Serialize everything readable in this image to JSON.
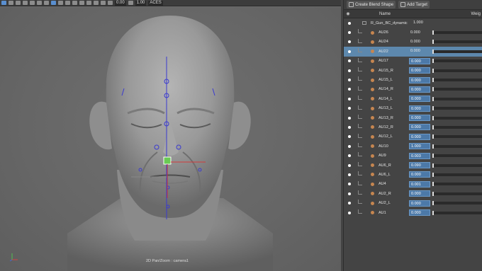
{
  "toolbar": {
    "field1": "0.00",
    "field2": "1.00",
    "color_space": "ACES"
  },
  "viewport": {
    "camera_label": "2D Pan/Zoom : camera1"
  },
  "panel": {
    "create_blend_shape": "Create Blend Shape",
    "add_target": "Add Target",
    "col_name": "Name",
    "col_weight": "Weig"
  },
  "blendshape": {
    "name": "R_Gun_BC_dynamic",
    "value": "1.000"
  },
  "targets": [
    {
      "name": "AU26",
      "value": "0.000",
      "boxed": false,
      "selected": false
    },
    {
      "name": "AU24",
      "value": "0.000",
      "boxed": false,
      "selected": false
    },
    {
      "name": "AU22",
      "value": "0.000",
      "boxed": false,
      "selected": true
    },
    {
      "name": "AU17",
      "value": "0.000",
      "boxed": true,
      "selected": false
    },
    {
      "name": "AU15_R",
      "value": "0.000",
      "boxed": true,
      "selected": false
    },
    {
      "name": "AU15_L",
      "value": "0.000",
      "boxed": true,
      "selected": false
    },
    {
      "name": "AU14_R",
      "value": "0.000",
      "boxed": true,
      "selected": false
    },
    {
      "name": "AU14_L",
      "value": "0.000",
      "boxed": true,
      "selected": false
    },
    {
      "name": "AU13_L",
      "value": "0.000",
      "boxed": true,
      "selected": false
    },
    {
      "name": "AU13_R",
      "value": "0.000",
      "boxed": true,
      "selected": false
    },
    {
      "name": "AU12_R",
      "value": "0.000",
      "boxed": true,
      "selected": false
    },
    {
      "name": "AU12_L",
      "value": "0.000",
      "boxed": true,
      "selected": false
    },
    {
      "name": "AU10",
      "value": "1.000",
      "boxed": true,
      "selected": false
    },
    {
      "name": "AU9",
      "value": "0.003",
      "boxed": true,
      "selected": false
    },
    {
      "name": "AU6_R",
      "value": "0.090",
      "boxed": true,
      "selected": false
    },
    {
      "name": "AU6_L",
      "value": "0.000",
      "boxed": true,
      "selected": false
    },
    {
      "name": "AU4",
      "value": "0.001",
      "boxed": true,
      "selected": false
    },
    {
      "name": "AU2_R",
      "value": "0.000",
      "boxed": true,
      "selected": false
    },
    {
      "name": "AU2_L",
      "value": "0.000",
      "boxed": true,
      "selected": false
    },
    {
      "name": "AU1",
      "value": "0.000",
      "boxed": true,
      "selected": false
    }
  ],
  "colors": {
    "accent": "#5d88ad",
    "target_dot": "#c68650",
    "locator": "#4444cc"
  }
}
